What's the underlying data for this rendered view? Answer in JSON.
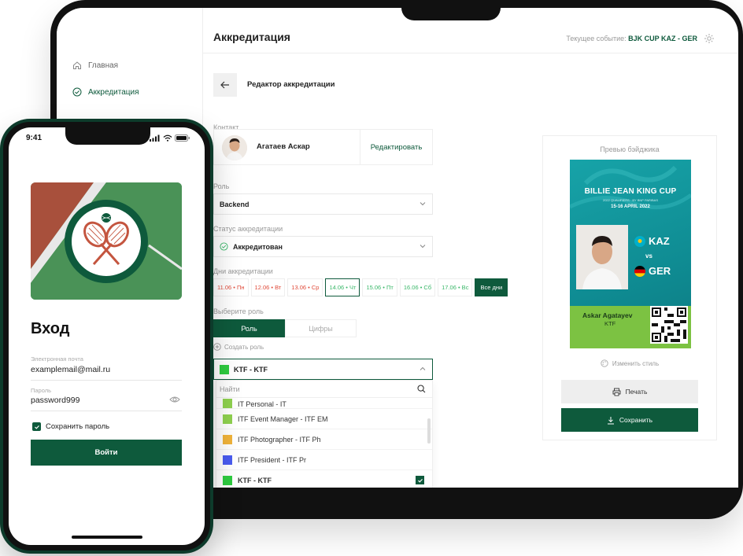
{
  "tablet": {
    "sidebar": {
      "items": [
        {
          "label": "Главная",
          "icon": "home-icon"
        },
        {
          "label": "Аккредитация",
          "icon": "check-circle-icon"
        }
      ]
    },
    "header": {
      "title": "Аккредитация",
      "event_label": "Текущее событие:",
      "event_value": "BJK CUP KAZ - GER"
    },
    "editor": {
      "title": "Редактор аккредитации",
      "contact_label": "Контакт",
      "contact_name": "Агатаев Аскар",
      "edit_label": "Редактировать",
      "role_label": "Роль",
      "role_value": "Backend",
      "status_label": "Статус аккредитации",
      "status_value": "Аккредитован",
      "days_label": "Дни аккредитации",
      "days": [
        {
          "label": "11.06 • Пн",
          "state": "red"
        },
        {
          "label": "12.06 • Вт",
          "state": "red"
        },
        {
          "label": "13.06 • Ср",
          "state": "red"
        },
        {
          "label": "14.06 • Чт",
          "state": "selected"
        },
        {
          "label": "15.06 • Пт",
          "state": "green"
        },
        {
          "label": "16.06 • Сб",
          "state": "green"
        },
        {
          "label": "17.06 • Вс",
          "state": "green"
        }
      ],
      "all_days": "Все дни",
      "choose_role_label": "Выберите роль",
      "tabs": [
        "Роль",
        "Цифры"
      ],
      "create_role": "Создать роль",
      "selected_role": "KTF - KTF",
      "search_placeholder": "Найти",
      "dropdown_items": [
        {
          "label": "IT Personal - IT",
          "color": "#8fd14f"
        },
        {
          "label": "ITF Event Manager - ITF EM",
          "color": "#8fd14f"
        },
        {
          "label": "ITF Photographer - ITF Ph",
          "color": "#f0b33a"
        },
        {
          "label": "ITF President - ITF Pr",
          "color": "#4a5cf0"
        },
        {
          "label": "KTF - KTF",
          "color": "#2ecc40"
        }
      ]
    },
    "preview": {
      "label": "Превью бэйджика",
      "badge_title": "BILLIE JEAN KING CUP",
      "badge_sub": "2022 QUALIFIERS · BY BNP PARIBAS",
      "badge_date": "15-16 APRIL 2022",
      "team1": "KAZ",
      "vs": "vs",
      "team2": "GER",
      "person_name": "Askar Agatayev",
      "person_role": "KTF",
      "change_style": "Изменить стиль",
      "print": "Печать",
      "save": "Сохранить"
    }
  },
  "phone": {
    "time": "9:41",
    "heading": "Вход",
    "email_label": "Электронная почта",
    "email_value": "examplemail@mail.ru",
    "password_label": "Пароль",
    "password_value": "password999",
    "remember": "Сохранить пароль",
    "login_button": "Войти"
  },
  "colors": {
    "brand": "#0e5a3c",
    "badge_teal": "#17a3a8",
    "badge_green": "#7cc242",
    "day_red": "#e04b3a",
    "day_green": "#3bb86a"
  }
}
